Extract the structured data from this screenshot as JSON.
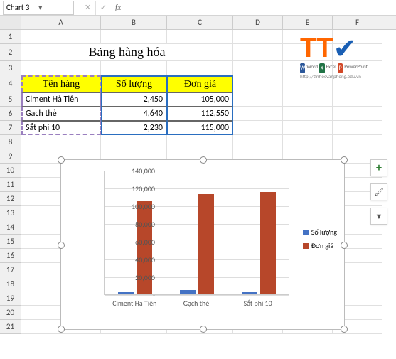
{
  "namebox": "Chart 3",
  "fx": "fx",
  "columns": [
    "A",
    "B",
    "C",
    "D",
    "E",
    "F"
  ],
  "rows": [
    1,
    2,
    3,
    4,
    5,
    6,
    7,
    8,
    9,
    10,
    11,
    12,
    13,
    14,
    15,
    16,
    17,
    18,
    19,
    20,
    21
  ],
  "title": "Bảng hàng hóa",
  "headers": {
    "name": "Tên hàng",
    "qty": "Số lượng",
    "price": "Đơn giá"
  },
  "data": [
    {
      "name": "Ciment Hà Tiên",
      "qty": "2,450",
      "price": "105,000"
    },
    {
      "name": "Gạch thẻ",
      "qty": "4,640",
      "price": "112,550"
    },
    {
      "name": "Sắt phi 10",
      "qty": "2,230",
      "price": "115,000"
    }
  ],
  "chart_data": {
    "type": "bar",
    "categories": [
      "Ciment Hà Tiên",
      "Gạch thẻ",
      "Sắt phi 10"
    ],
    "series": [
      {
        "name": "Số lượng",
        "values": [
          2450,
          4640,
          2230
        ],
        "color": "#4472c4"
      },
      {
        "name": "Đơn giá",
        "values": [
          105000,
          112550,
          115000
        ],
        "color": "#b7472a"
      }
    ],
    "ylim": [
      0,
      140000
    ],
    "yticks": [
      0,
      20000,
      40000,
      60000,
      80000,
      100000,
      120000,
      140000
    ],
    "ytick_labels": [
      "-",
      "20,000",
      "40,000",
      "60,000",
      "80,000",
      "100,000",
      "120,000",
      "140,000"
    ]
  },
  "logo": {
    "url": "http://tinhocvanphong.edu.vn",
    "apps": [
      "Word",
      "Excel",
      "PowerPoint"
    ]
  }
}
